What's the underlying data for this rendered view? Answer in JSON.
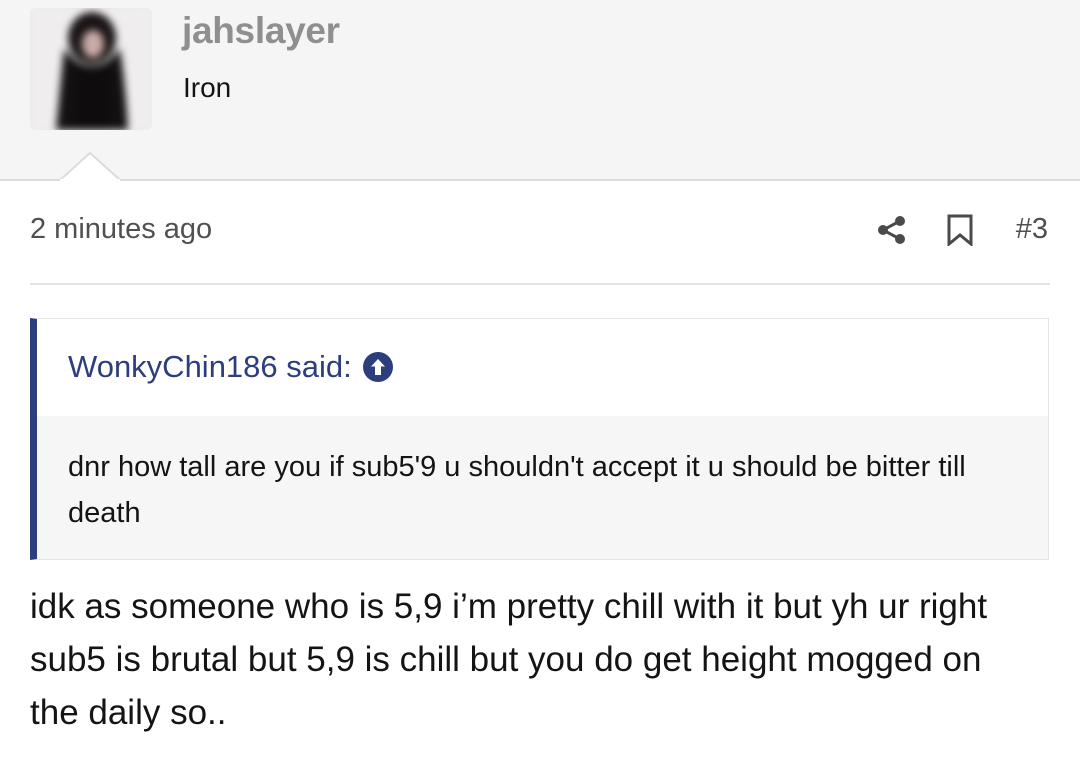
{
  "user": {
    "username": "jahslayer",
    "title": "Iron"
  },
  "meta": {
    "timestamp": "2 minutes ago",
    "post_number": "#3",
    "share_icon": "share-icon",
    "bookmark_icon": "bookmark-icon"
  },
  "quote": {
    "author_said": "WonkyChin186 said:",
    "jump_icon": "arrow-up-circle-icon",
    "text": "dnr how tall are you if sub5'9 u shouldn't accept it u should be bitter till death",
    "accent_color": "#2c3e7b"
  },
  "post": {
    "text": "idk as someone who is 5,9 i’m pretty chill with it but yh ur right sub5 is brutal but 5,9 is chill but you do get height mogged on the daily so.."
  }
}
